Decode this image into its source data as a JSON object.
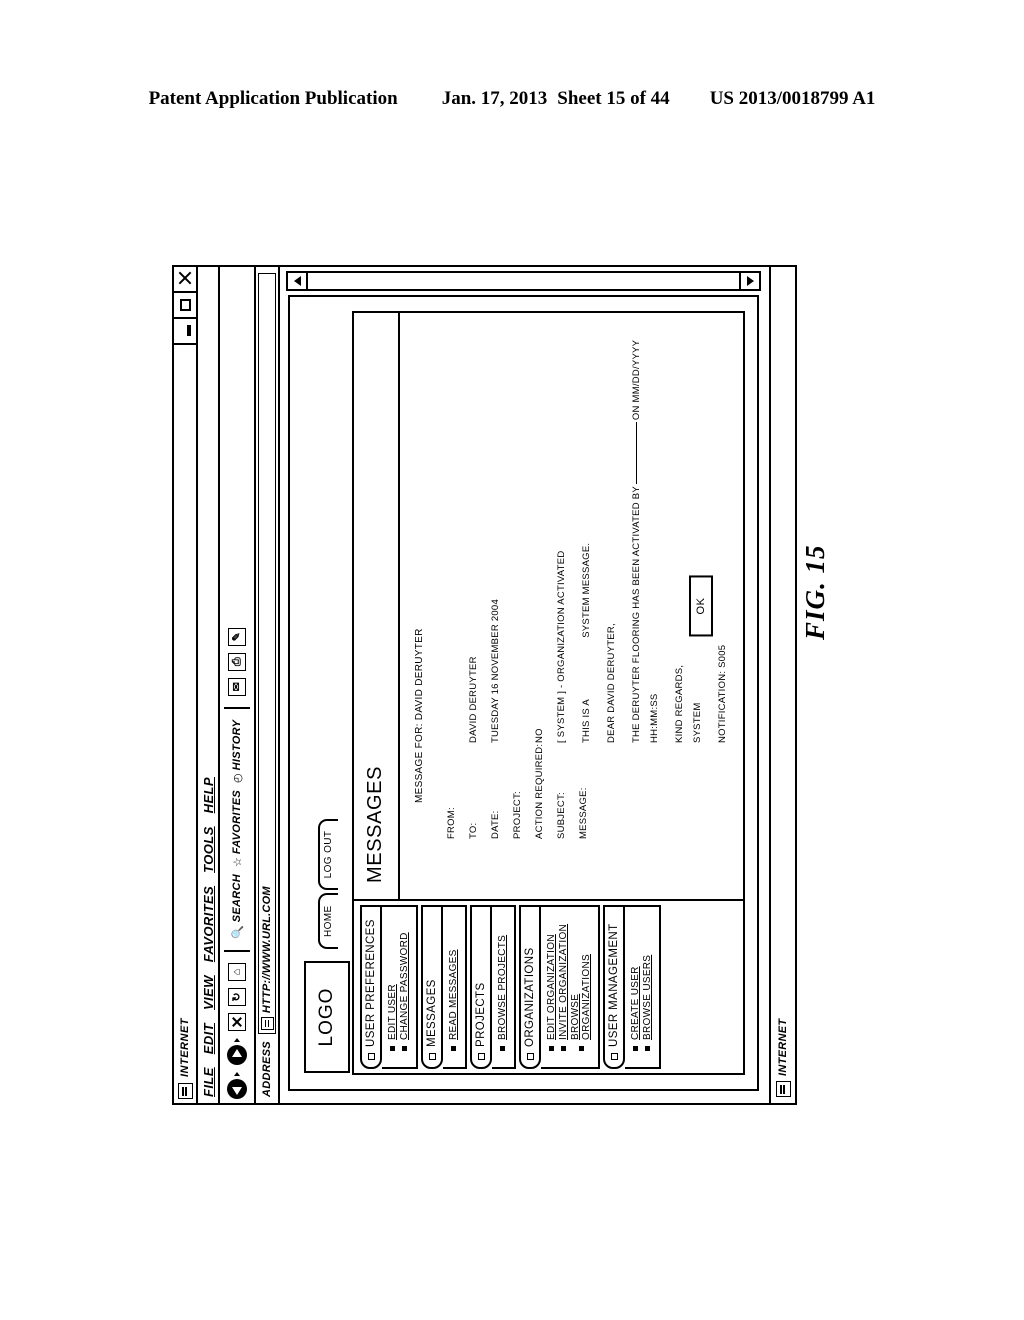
{
  "patent_header": {
    "publication": "Patent Application Publication",
    "date": "Jan. 17, 2013",
    "sheet": "Sheet 15 of 44",
    "number": "US 2013/0018799 A1"
  },
  "figure_label": "FIG. 15",
  "browser": {
    "title": "INTERNET",
    "window_controls": {
      "minimize": "minimize-icon",
      "maximize": "maximize-icon",
      "close": "close-icon"
    },
    "menu": [
      "FILE",
      "EDIT",
      "VIEW",
      "FAVORITES",
      "TOOLS",
      "HELP"
    ],
    "toolbar": {
      "back": "back-arrow-icon",
      "forward": "forward-arrow-icon",
      "stop": "stop-icon",
      "refresh": "refresh-icon",
      "home": "home-icon",
      "search_label": "SEARCH",
      "favorites_label": "FAVORITES",
      "history_label": "HISTORY",
      "mail": "mail-icon",
      "print": "print-icon",
      "edit": "edit-icon"
    },
    "address": {
      "label": "ADDRESS",
      "url": "HTTP://WWW.URL.COM"
    },
    "status": "INTERNET"
  },
  "webpage": {
    "logo": "LOGO",
    "tabs": [
      "HOME",
      "LOG OUT"
    ],
    "nav_groups": [
      {
        "title": "USER PREFERENCES",
        "items": [
          "EDIT USER",
          "CHANGE PASSWORD"
        ]
      },
      {
        "title": "MESSAGES",
        "items": [
          "READ MESSAGES"
        ]
      },
      {
        "title": "PROJECTS",
        "items": [
          "BROWSE PROJECTS"
        ]
      },
      {
        "title": "ORGANIZATIONS",
        "items": [
          "EDIT ORGANIZATION",
          "INVITE ORGANIZATION",
          "BROWSE ORGANIZATIONS"
        ]
      },
      {
        "title": "USER MANAGEMENT",
        "items": [
          "CREATE USER",
          "BROWSE USERS"
        ]
      }
    ],
    "page_title": "MESSAGES",
    "message_for": "MESSAGE FOR:  DAVID DERUYTER",
    "fields": [
      {
        "label": "FROM:",
        "value": ""
      },
      {
        "label": "TO:",
        "value": "DAVID DERUYTER"
      },
      {
        "label": "DATE:",
        "value": "TUESDAY 16 NOVEMBER 2004"
      },
      {
        "label": "PROJECT:",
        "value": ""
      },
      {
        "label": "ACTION REQUIRED:",
        "value": "NO"
      },
      {
        "label": "SUBJECT:",
        "value": "[ SYSTEM ] - ORGANIZATION ACTIVATED"
      }
    ],
    "message_label": "MESSAGE:",
    "message_lines": {
      "l1": "THIS IS A",
      "l1b": "SYSTEM MESSAGE.",
      "l2": "DEAR DAVID DERUYTER,",
      "l3a": "THE DERUYTER FLOORING HAS BEEN ACTIVATED BY",
      "l3b": "ON MM/DD/YYYY HH:MM:SS",
      "l4": "KIND REGARDS,",
      "l5": "SYSTEM",
      "l6": "NOTIFICATION: S005"
    },
    "ok_button": "OK"
  }
}
